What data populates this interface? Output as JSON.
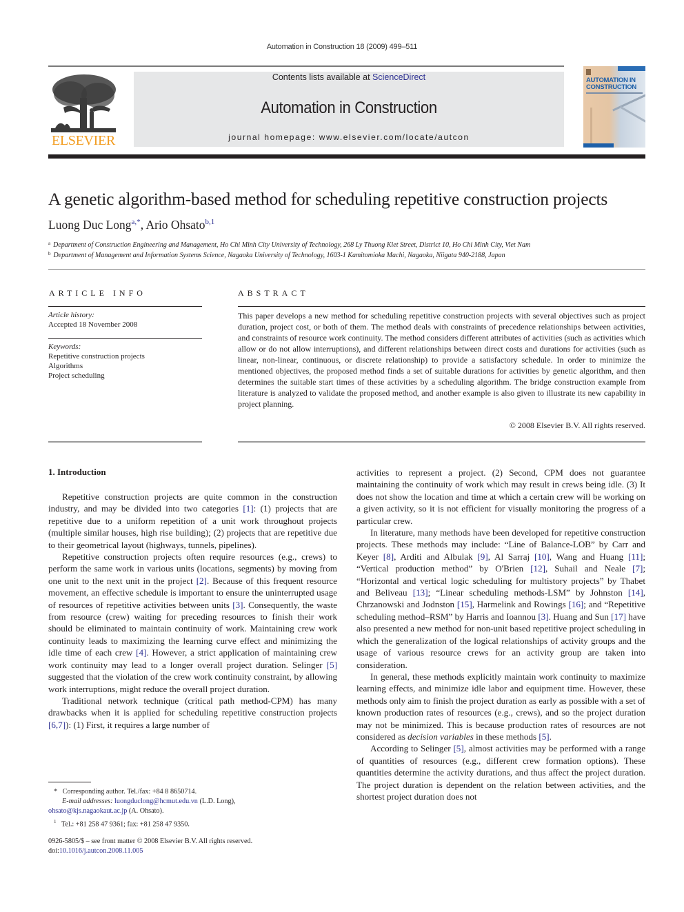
{
  "header": {
    "journal_reference": "Automation in Construction 18 (2009) 499–511",
    "contents_prefix": "Contents lists available at ",
    "contents_link": "ScienceDirect",
    "journal_title": "Automation in Construction",
    "homepage_prefix": "journal homepage: ",
    "homepage_url": "www.elsevier.com/locate/autcon",
    "publisher_logo": "ELSEVIER",
    "cover_title_line1": "AUTOMATION IN",
    "cover_title_line2": "CONSTRUCTION"
  },
  "article": {
    "title": "A genetic algorithm-based method for scheduling repetitive construction projects",
    "authors": [
      {
        "name": "Luong Duc Long",
        "marks": "a,*"
      },
      {
        "name": "Ario Ohsato",
        "marks": "b,1"
      }
    ],
    "author_separator": ", ",
    "affiliations": [
      {
        "mark": "a",
        "text": "Department of Construction Engineering and Management, Ho Chi Minh City University of Technology, 268 Ly Thuong Kiet Street, District 10, Ho Chi Minh City, Viet Nam"
      },
      {
        "mark": "b",
        "text": "Department of Management and Information Systems Science, Nagaoka University of Technology, 1603-1 Kamitomioka Machi, Nagaoka, Niigata 940-2188, Japan"
      }
    ]
  },
  "article_info": {
    "heading": "ARTICLE INFO",
    "history_label": "Article history:",
    "history_value": "Accepted 18 November 2008",
    "keywords_label": "Keywords:",
    "keywords": [
      "Repetitive construction projects",
      "Algorithms",
      "Project scheduling"
    ]
  },
  "abstract": {
    "heading": "ABSTRACT",
    "text": "This paper develops a new method for scheduling repetitive construction projects with several objectives such as project duration, project cost, or both of them. The method deals with constraints of precedence relationships between activities, and constraints of resource work continuity. The method considers different attributes of activities (such as activities which allow or do not allow interruptions), and different relationships between direct costs and durations for activities (such as linear, non-linear, continuous, or discrete relationship) to provide a satisfactory schedule. In order to minimize the mentioned objectives, the proposed method finds a set of suitable durations for activities by genetic algorithm, and then determines the suitable start times of these activities by a scheduling algorithm. The bridge construction example from literature is analyzed to validate the proposed method, and another example is also given to illustrate its new capability in project planning.",
    "copyright": "© 2008 Elsevier B.V. All rights reserved."
  },
  "body": {
    "section_heading": "1. Introduction",
    "left": {
      "p1": [
        "Repetitive construction projects are quite common in the con­struction industry, and may be divided into two categories ",
        "[1]",
        ": (1) projects that are repetitive due to a uniform repetition of a unit work throughout projects (multiple similar houses, high rise build­ing); (2) projects that are repetitive due to their geometrical layout (highways, tunnels, pipelines)."
      ],
      "p2": [
        "Repetitive construction projects often require resources (e.g., crews) to perform the same work in various units (locations, segments) by moving from one unit to the next unit in the project ",
        "[2]",
        ". Because of this frequent resource movement, an effective schedule is important to ensure the uninterrupted usage of resources of repetitive activities between units ",
        "[3]",
        ". Consequently, the waste from resource (crew) waiting for preceding resources to finish their work should be eliminated to maintain continuity of work. Maintaining crew work continuity leads to maximizing the learning curve effect and minimizing the idle time of each crew ",
        "[4]",
        ". However, a strict application of maintaining crew work continuity may lead to a longer overall project duration. Selinger ",
        "[5]",
        " suggested that the violation of the crew work continuity constraint, by allowing work interruptions, might reduce the overall project duration."
      ],
      "p3": [
        "Traditional network technique (critical path method-CPM) has many drawbacks when it is applied for scheduling repetitive construction projects ",
        "[6,7]",
        "): (1) First, it requires a large number of"
      ]
    },
    "right": {
      "p1": "activities to represent a project. (2) Second, CPM does not guarantee maintaining the continuity of work which may result in crews being idle. (3) It does not show the location and time at which a certain crew will be working on a given activity, so it is not efficient for visually monitoring the progress of a particular crew.",
      "p2": [
        "In literature, many methods have been developed for repetitive construction projects. These methods may include: “Line of Balance-LOB” by Carr and Keyer ",
        "[8]",
        ", Arditi and Albulak ",
        "[9]",
        ", Al Sarraj ",
        "[10]",
        ", Wang and Huang ",
        "[11]",
        "; “Vertical production method” by O'Brien ",
        "[12]",
        ", Suhail and Neale ",
        "[7]",
        "; “Horizontal and vertical logic scheduling for multistory projects” by Thabet and Beliveau ",
        "[13]",
        "; “Linear scheduling methods-LSM” by Johnston ",
        "[14]",
        ", Chrzanowski and Jodnston ",
        "[15]",
        ", Harmelink and Rowings ",
        "[16]",
        "; and “Repetitive scheduling method–RSM” by Harris and Ioannou ",
        "[3]",
        ". Huang and Sun ",
        "[17]",
        " have also presented a new method for non-unit based repetitive project scheduling in which the generalization of the logical relationships of activity groups and the usage of various resource crews for an activity group are taken into consideration."
      ],
      "p3": [
        "In general, these methods explicitly maintain work continuity to maximize learning effects, and minimize idle labor and equipment time. However, these methods only aim to finish the project duration as early as possible with a set of known production rates of resources (e.g., crews), and so the project duration may not be minimized. This is because production rates of resources are not considered as ",
        "decision variables",
        " in these methods ",
        "[5]",
        "."
      ],
      "p4": [
        "According to Selinger ",
        "[5]",
        ", almost activities may be performed with a range of quantities of resources (e.g., different crew formation options). These quantities determine the activity durations, and thus affect the project duration. The project duration is dependent on the relation between activities, and the shortest project duration does not"
      ]
    }
  },
  "footnotes": {
    "corresponding_mark": "*",
    "corresponding_text": "Corresponding author. Tel./fax: +84 8 8650714.",
    "email_label": "E-mail addresses:",
    "email1": "luongduclong@hcmut.edu.vn",
    "email1_owner": " (L.D. Long),",
    "email2": "ohsato@kjs.nagaokaut.ac.jp",
    "email2_owner": " (A. Ohsato).",
    "note1_mark": "1",
    "note1_text": "Tel.: +81 258 47 9361; fax: +81 258 47 9350.",
    "front_matter": "0926-5805/$ – see front matter © 2008 Elsevier B.V. All rights reserved.",
    "doi_label": "doi:",
    "doi": "10.1016/j.autcon.2008.11.005"
  },
  "colors": {
    "link": "#2e3192",
    "elsevier_orange": "#f29c1f",
    "banner_grey": "#e6e7e8",
    "text": "#231f20"
  }
}
